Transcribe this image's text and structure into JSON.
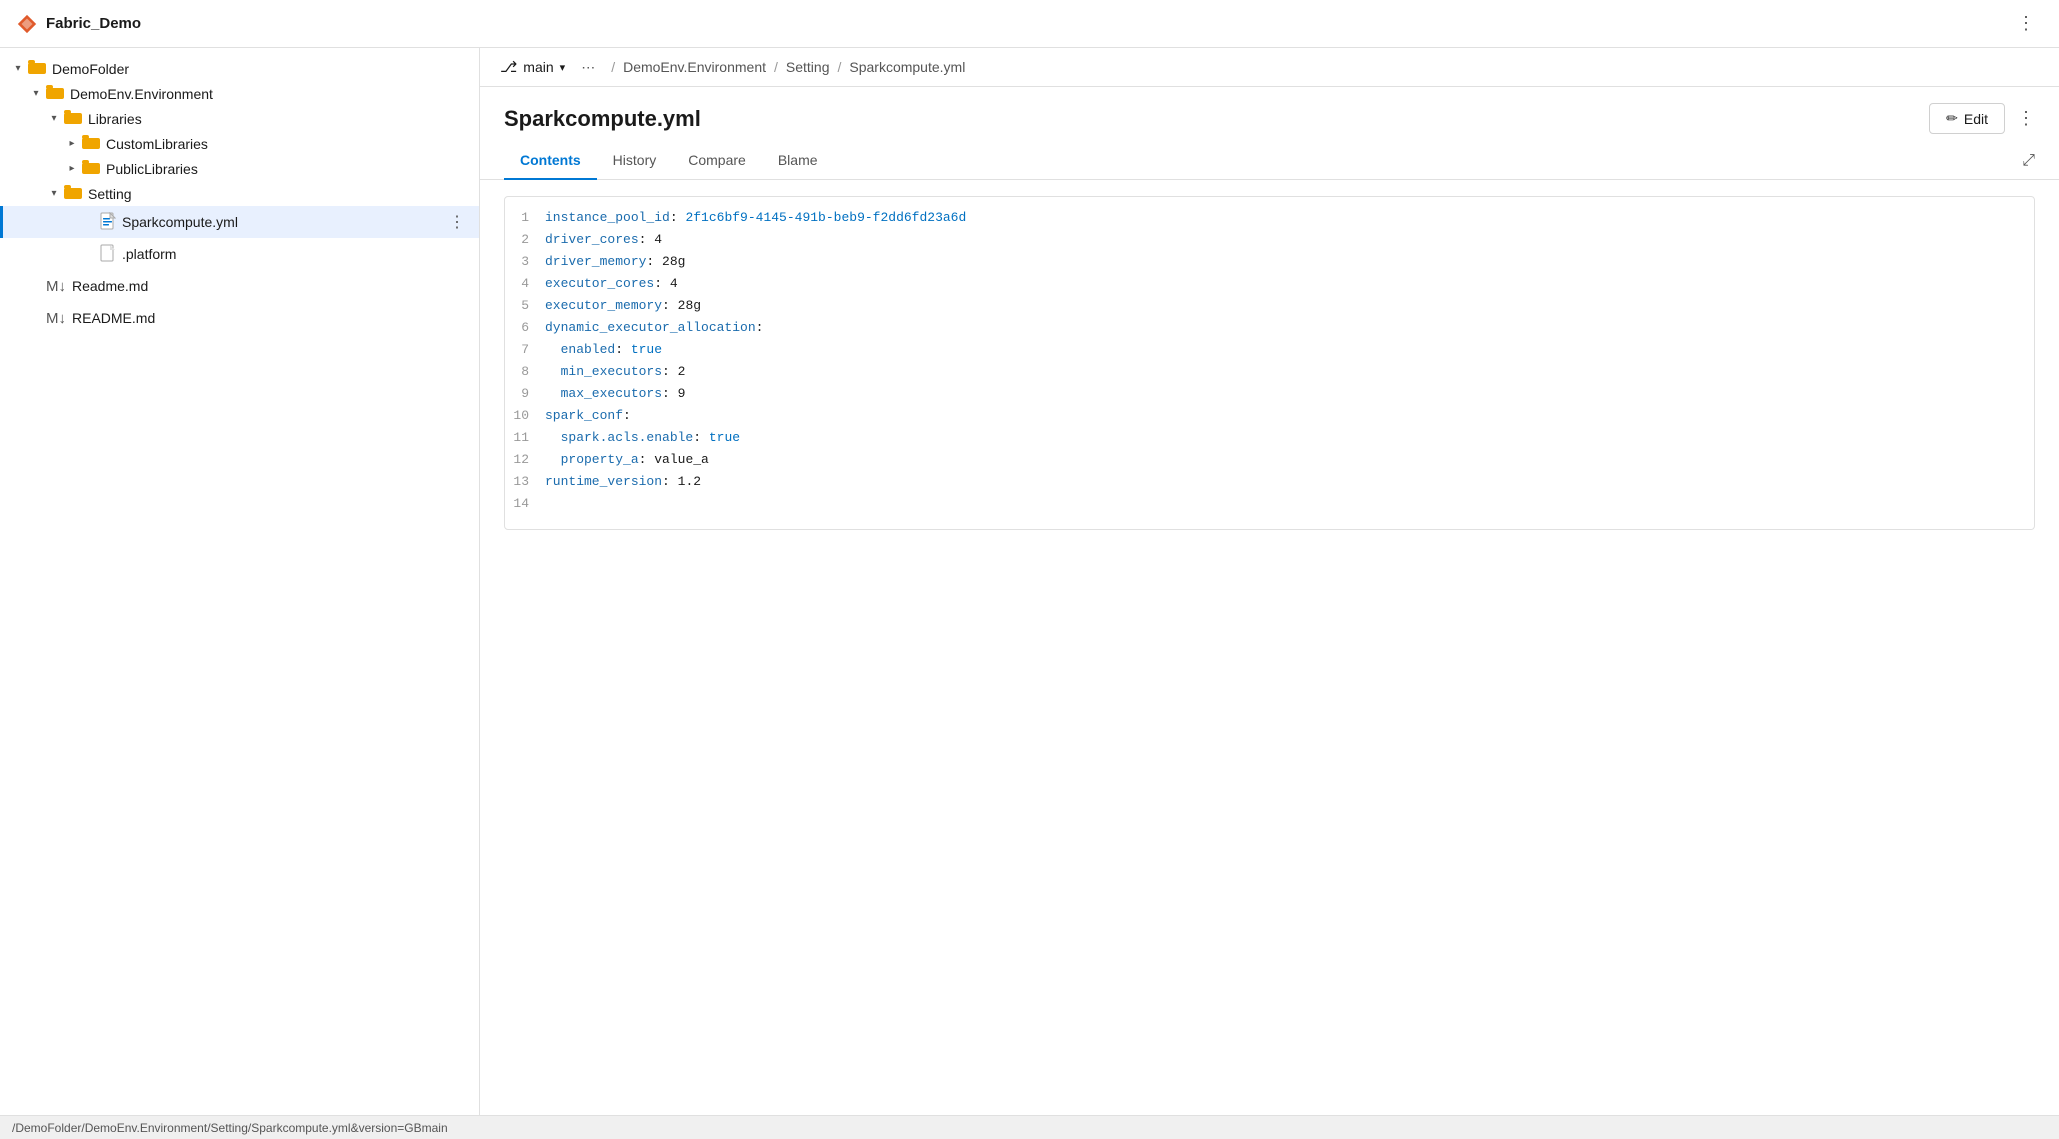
{
  "app": {
    "title": "Fabric_Demo",
    "logo_label": "Fabric_Demo"
  },
  "sidebar": {
    "items": [
      {
        "id": "demofolder",
        "label": "DemoFolder",
        "type": "folder",
        "indent": 0,
        "expanded": true,
        "chevron": "▼"
      },
      {
        "id": "demoenv",
        "label": "DemoEnv.Environment",
        "type": "folder",
        "indent": 1,
        "expanded": true,
        "chevron": "▼"
      },
      {
        "id": "libraries",
        "label": "Libraries",
        "type": "folder",
        "indent": 2,
        "expanded": true,
        "chevron": "▼"
      },
      {
        "id": "customlibs",
        "label": "CustomLibraries",
        "type": "folder",
        "indent": 3,
        "expanded": false,
        "chevron": "▶"
      },
      {
        "id": "publiclibs",
        "label": "PublicLibraries",
        "type": "folder",
        "indent": 3,
        "expanded": false,
        "chevron": "▶"
      },
      {
        "id": "setting",
        "label": "Setting",
        "type": "folder",
        "indent": 2,
        "expanded": true,
        "chevron": "▼"
      },
      {
        "id": "sparkcompute",
        "label": "Sparkcompute.yml",
        "type": "yml",
        "indent": 4,
        "active": true
      },
      {
        "id": "platform",
        "label": ".platform",
        "type": "file",
        "indent": 4,
        "active": false
      },
      {
        "id": "readmemd",
        "label": "Readme.md",
        "type": "md",
        "indent": 1,
        "active": false
      },
      {
        "id": "README",
        "label": "README.md",
        "type": "md",
        "indent": 1,
        "active": false
      }
    ]
  },
  "breadcrumb": {
    "branch_icon": "⎇",
    "branch": "main",
    "sep1": "/",
    "crumb1": "DemoEnv.Environment",
    "sep2": "/",
    "crumb2": "Setting",
    "sep3": "/",
    "crumb3": "Sparkcompute.yml"
  },
  "file": {
    "title": "Sparkcompute.yml",
    "edit_label": "Edit",
    "tabs": [
      "Contents",
      "History",
      "Compare",
      "Blame"
    ]
  },
  "code": {
    "lines": [
      {
        "num": "1",
        "content": "instance_pool_id: 2f1c6bf9-4145-491b-beb9-f2dd6fd23a6d",
        "key": "instance_pool_id",
        "colon": ": ",
        "val": "2f1c6bf9-4145-491b-beb9-f2dd6fd23a6d",
        "val_type": "string"
      },
      {
        "num": "2",
        "content": "driver_cores: 4",
        "key": "driver_cores",
        "colon": ": ",
        "val": "4",
        "val_type": "num"
      },
      {
        "num": "3",
        "content": "driver_memory: 28g",
        "key": "driver_memory",
        "colon": ": ",
        "val": "28g",
        "val_type": "num"
      },
      {
        "num": "4",
        "content": "executor_cores: 4",
        "key": "executor_cores",
        "colon": ": ",
        "val": "4",
        "val_type": "num"
      },
      {
        "num": "5",
        "content": "executor_memory: 28g",
        "key": "executor_memory",
        "colon": ": ",
        "val": "28g",
        "val_type": "num"
      },
      {
        "num": "6",
        "content": "dynamic_executor_allocation:",
        "key": "dynamic_executor_allocation",
        "colon": ":",
        "val": "",
        "val_type": "none"
      },
      {
        "num": "7",
        "content": "  enabled: true",
        "key": "  enabled",
        "colon": ": ",
        "val": "true",
        "val_type": "bool",
        "indent": true
      },
      {
        "num": "8",
        "content": "  min_executors: 2",
        "key": "  min_executors",
        "colon": ": ",
        "val": "2",
        "val_type": "num",
        "indent": true
      },
      {
        "num": "9",
        "content": "  max_executors: 9",
        "key": "  max_executors",
        "colon": ": ",
        "val": "9",
        "val_type": "num",
        "indent": true
      },
      {
        "num": "10",
        "content": "spark_conf:",
        "key": "spark_conf",
        "colon": ":",
        "val": "",
        "val_type": "none"
      },
      {
        "num": "11",
        "content": "  spark.acls.enable: true",
        "key": "  spark.acls.enable",
        "colon": ": ",
        "val": "true",
        "val_type": "bool",
        "indent": true
      },
      {
        "num": "12",
        "content": "  property_a: value_a",
        "key": "  property_a",
        "colon": ": ",
        "val": "value_a",
        "val_type": "string2",
        "indent": true
      },
      {
        "num": "13",
        "content": "runtime_version: 1.2",
        "key": "runtime_version",
        "colon": ": ",
        "val": "1.2",
        "val_type": "num"
      },
      {
        "num": "14",
        "content": "",
        "key": "",
        "colon": "",
        "val": "",
        "val_type": "none"
      }
    ]
  },
  "status_bar": {
    "text": "/DemoFolder/DemoEnv.Environment/Setting/Sparkcompute.yml&version=GBmain"
  }
}
